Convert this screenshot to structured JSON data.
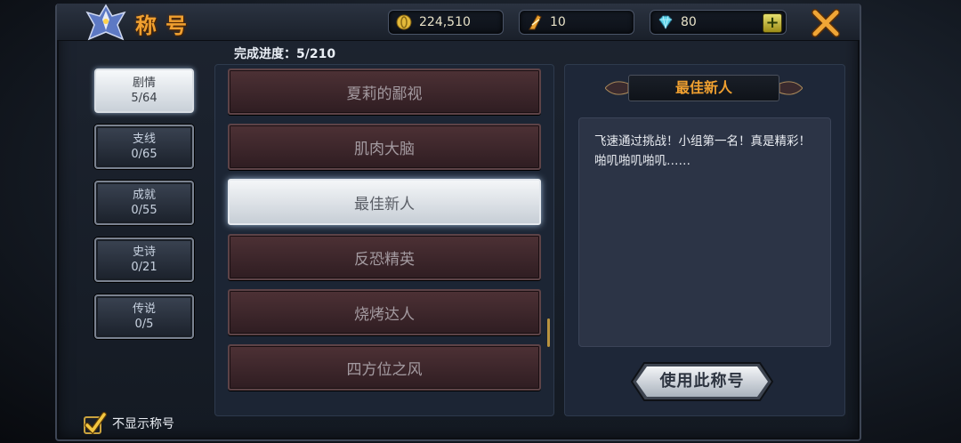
{
  "header": {
    "title": "称号",
    "gold": "224,510",
    "fuel": "10",
    "gems": "80",
    "plus_label": "+"
  },
  "progress": "完成进度：5/210",
  "tabs": [
    {
      "name": "剧情",
      "count": "5/64",
      "active": true
    },
    {
      "name": "支线",
      "count": "0/65",
      "active": false
    },
    {
      "name": "成就",
      "count": "0/55",
      "active": false
    },
    {
      "name": "史诗",
      "count": "0/21",
      "active": false
    },
    {
      "name": "传说",
      "count": "0/5",
      "active": false
    }
  ],
  "titles": [
    {
      "label": "夏莉的鄙视",
      "selected": false
    },
    {
      "label": "肌肉大脑",
      "selected": false
    },
    {
      "label": "最佳新人",
      "selected": true
    },
    {
      "label": "反恐精英",
      "selected": false
    },
    {
      "label": "烧烤达人",
      "selected": false
    },
    {
      "label": "四方位之风",
      "selected": false
    }
  ],
  "detail": {
    "name": "最佳新人",
    "description": "飞速通过挑战！小组第一名！真是精彩！啪叽啪叽啪叽……",
    "use_button": "使用此称号"
  },
  "hide_title_label": "不显示称号",
  "colors": {
    "accent": "#f0a030",
    "panel": "#1c2534",
    "item": "#3e272b"
  }
}
